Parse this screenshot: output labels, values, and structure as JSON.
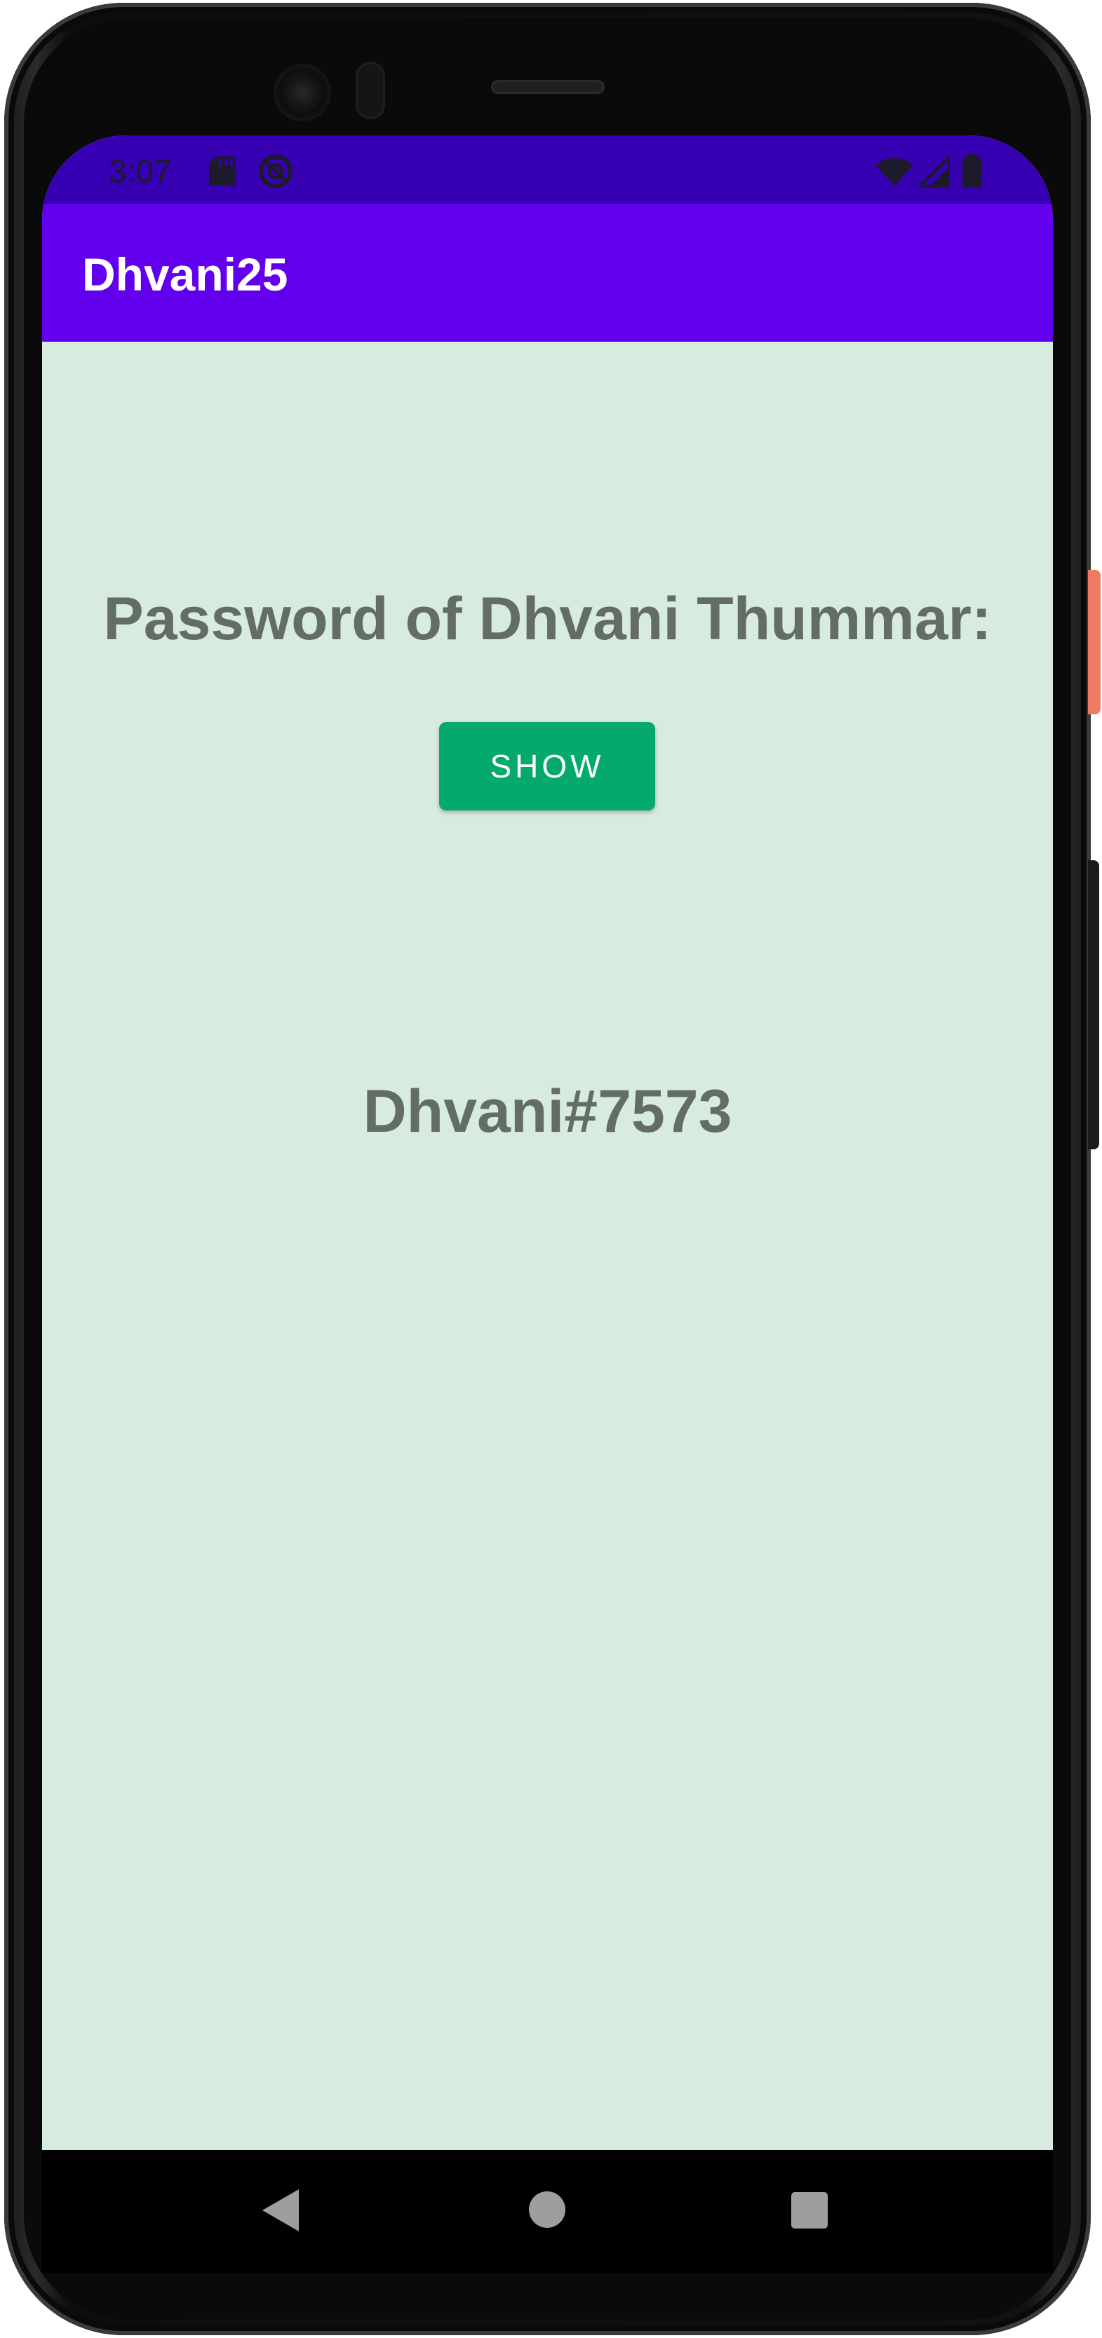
{
  "status_bar": {
    "time": "3:07",
    "icons_left": [
      "sd-card-icon",
      "do-not-disturb-icon"
    ],
    "icons_right": [
      "wifi-icon",
      "signal-icon",
      "battery-icon"
    ]
  },
  "app_bar": {
    "title": "Dhvani25"
  },
  "main": {
    "heading": "Password of Dhvani Thummar:",
    "show_button_label": "SHOW",
    "password_value": "Dhvani#7573"
  },
  "nav_bar": {
    "buttons": [
      "back-icon",
      "home-icon",
      "recents-icon"
    ]
  },
  "colors": {
    "status_bar": "#3700b3",
    "app_bar": "#6200ee",
    "background": "#d7ebdf",
    "button": "#04a96c",
    "text": "#646c66"
  }
}
